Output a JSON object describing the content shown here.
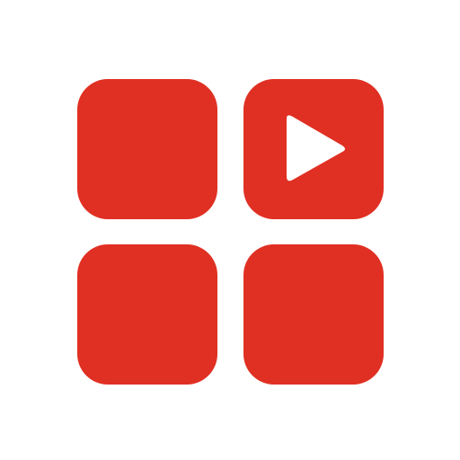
{
  "icon": {
    "name": "video-grid-icon",
    "accent_color": "#e03023",
    "background_color": "#ffffff",
    "tiles": [
      {
        "name": "grid-tile-top-left",
        "icon": "none"
      },
      {
        "name": "grid-tile-top-right",
        "icon": "play-icon"
      },
      {
        "name": "grid-tile-bottom-left",
        "icon": "none"
      },
      {
        "name": "grid-tile-bottom-right",
        "icon": "none"
      }
    ]
  }
}
